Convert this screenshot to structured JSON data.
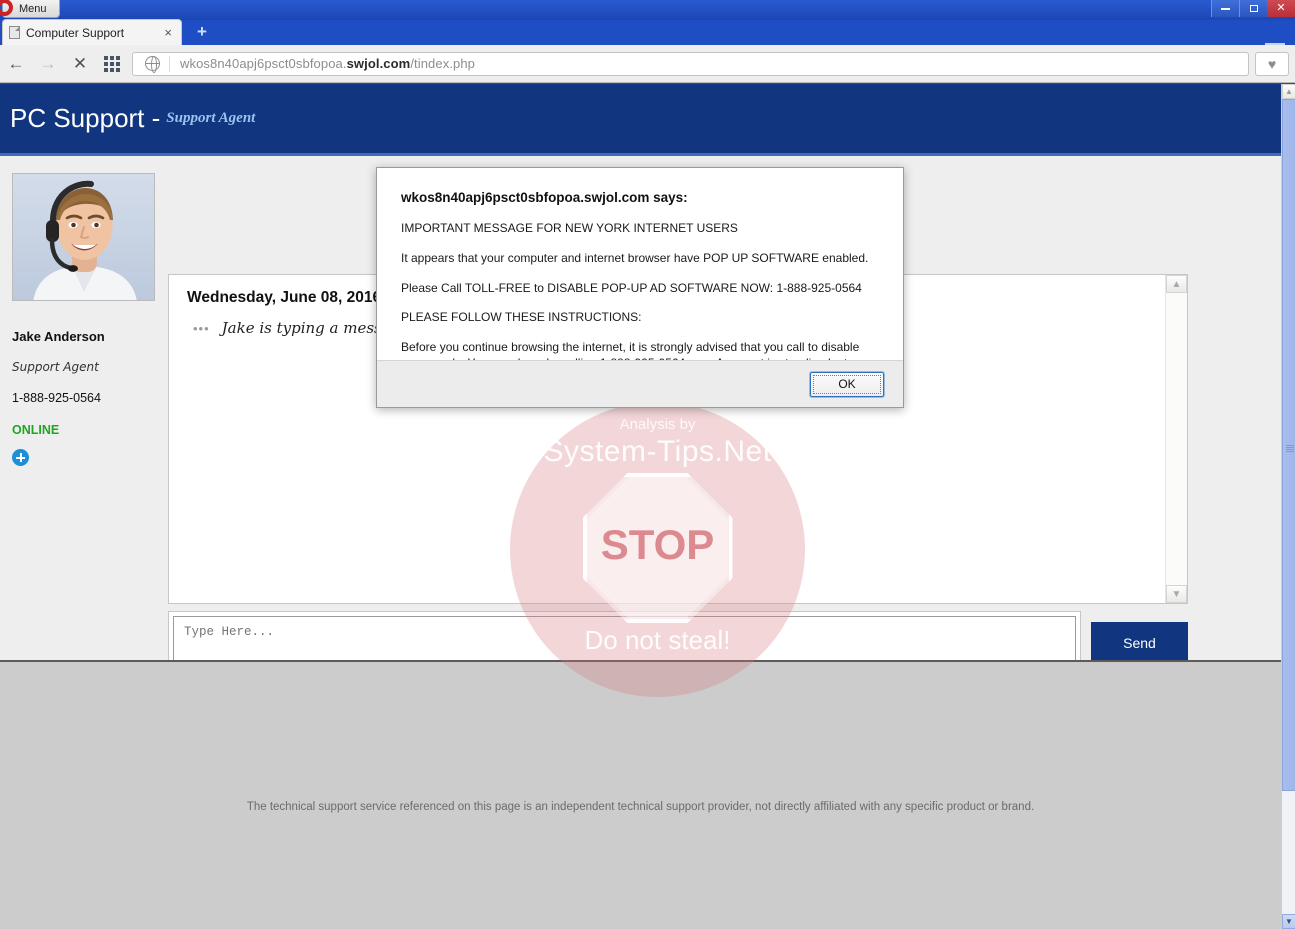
{
  "browser": {
    "menu_button": "Menu",
    "tab_title": "Computer Support",
    "tab_close": "×",
    "newtab": "+",
    "url_prefix": "wkos8n40apj6psct0sbfopoa.",
    "url_domain": "swjol.com",
    "url_suffix": "/tindex.php",
    "nav": {
      "back": "←",
      "forward": "→",
      "stop": "✕",
      "speeddial": "speed-dial-grid"
    },
    "heart": "♥",
    "window_controls": {
      "minimize": "minimize",
      "maximize": "maximize",
      "close": "✕"
    }
  },
  "site": {
    "title": "PC Support -",
    "subtitle": "Support Agent"
  },
  "agent": {
    "name": "Jake Anderson",
    "role": "Support Agent",
    "phone": "1-888-925-0564",
    "status": "ONLINE",
    "add_label": "+"
  },
  "chat": {
    "date": "Wednesday, June 08, 2016",
    "typing_dots": "•••",
    "typing_text": "Jake is typing a message",
    "scroll_up": "▲",
    "scroll_down": "▼"
  },
  "composer": {
    "placeholder": "Type Here...",
    "value": "",
    "send_label": "Send"
  },
  "footer": {
    "disclaimer": "The technical support service referenced on this page is an independent technical support provider, not directly affiliated with any specific product or brand."
  },
  "watermark": {
    "by": "Analysis by",
    "site": "System-Tips.Net",
    "stop": "STOP",
    "do_not_steal": "Do not steal!"
  },
  "dialog": {
    "title": "wkos8n40apj6psct0sbfopoa.swjol.com says:",
    "line1": "IMPORTANT MESSAGE FOR NEW YORK INTERNET USERS",
    "line2": "It appears that your computer and internet browser have POP UP SOFTWARE enabled.",
    "line3": "Please Call TOLL-FREE to DISABLE POP-UP AD SOFTWARE NOW: 1-888-925-0564",
    "line4": "PLEASE FOLLOW THESE INSTRUCTIONS:",
    "line5": "Before you continue browsing the internet, it is strongly advised that you call to disable pop-up ads. You can do so by calling 1-888-925-0564 now. An agent is standing by to take your call.",
    "ok_label": "OK"
  },
  "scrollbar": {
    "up": "▲",
    "down": "▼"
  },
  "colors": {
    "brand_navy": "#11367f",
    "browser_blue": "#1f4ec4",
    "online_green": "#22a522",
    "watermark_pink": "#d6787e"
  }
}
